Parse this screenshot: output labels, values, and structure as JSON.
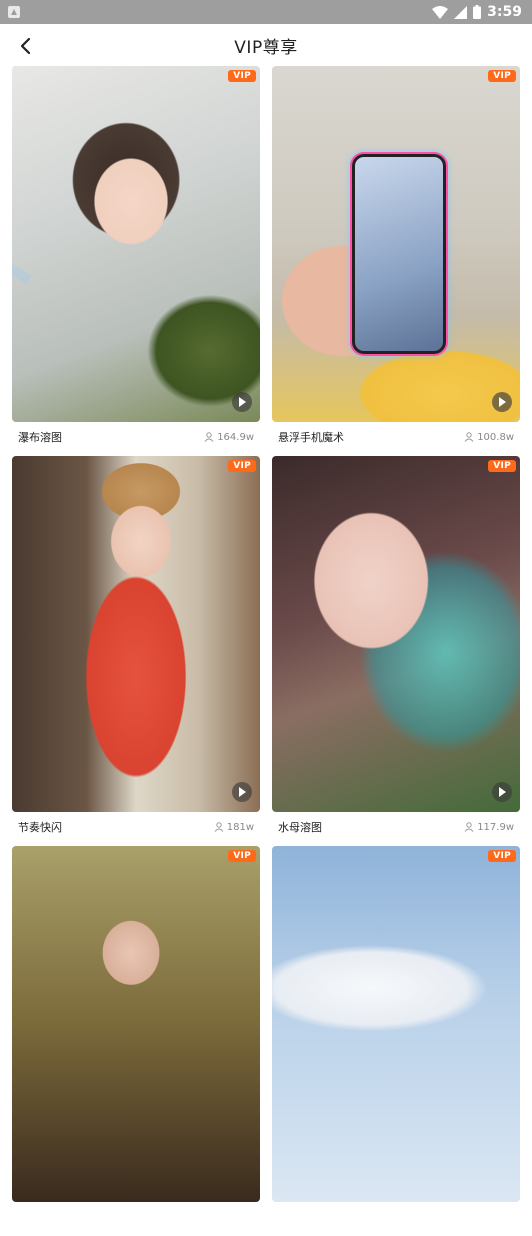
{
  "statusbar": {
    "time": "3:59"
  },
  "header": {
    "title": "VIP尊享"
  },
  "cards": [
    {
      "name": "瀑布溶图",
      "count": "164.9w",
      "badge": "VIP"
    },
    {
      "name": "悬浮手机魔术",
      "count": "100.8w",
      "badge": "VIP"
    },
    {
      "name": "节奏快闪",
      "count": "181w",
      "badge": "VIP"
    },
    {
      "name": "水母溶图",
      "count": "117.9w",
      "badge": "VIP"
    },
    {
      "name": "",
      "count": "",
      "badge": "VIP"
    },
    {
      "name": "",
      "count": "",
      "badge": "VIP"
    }
  ],
  "colors": {
    "vip_badge": "#ff6a1a",
    "statusbar": "#9e9e9e"
  },
  "icons": {
    "back": "chevron-left-icon",
    "play": "play-icon",
    "user": "user-icon"
  }
}
